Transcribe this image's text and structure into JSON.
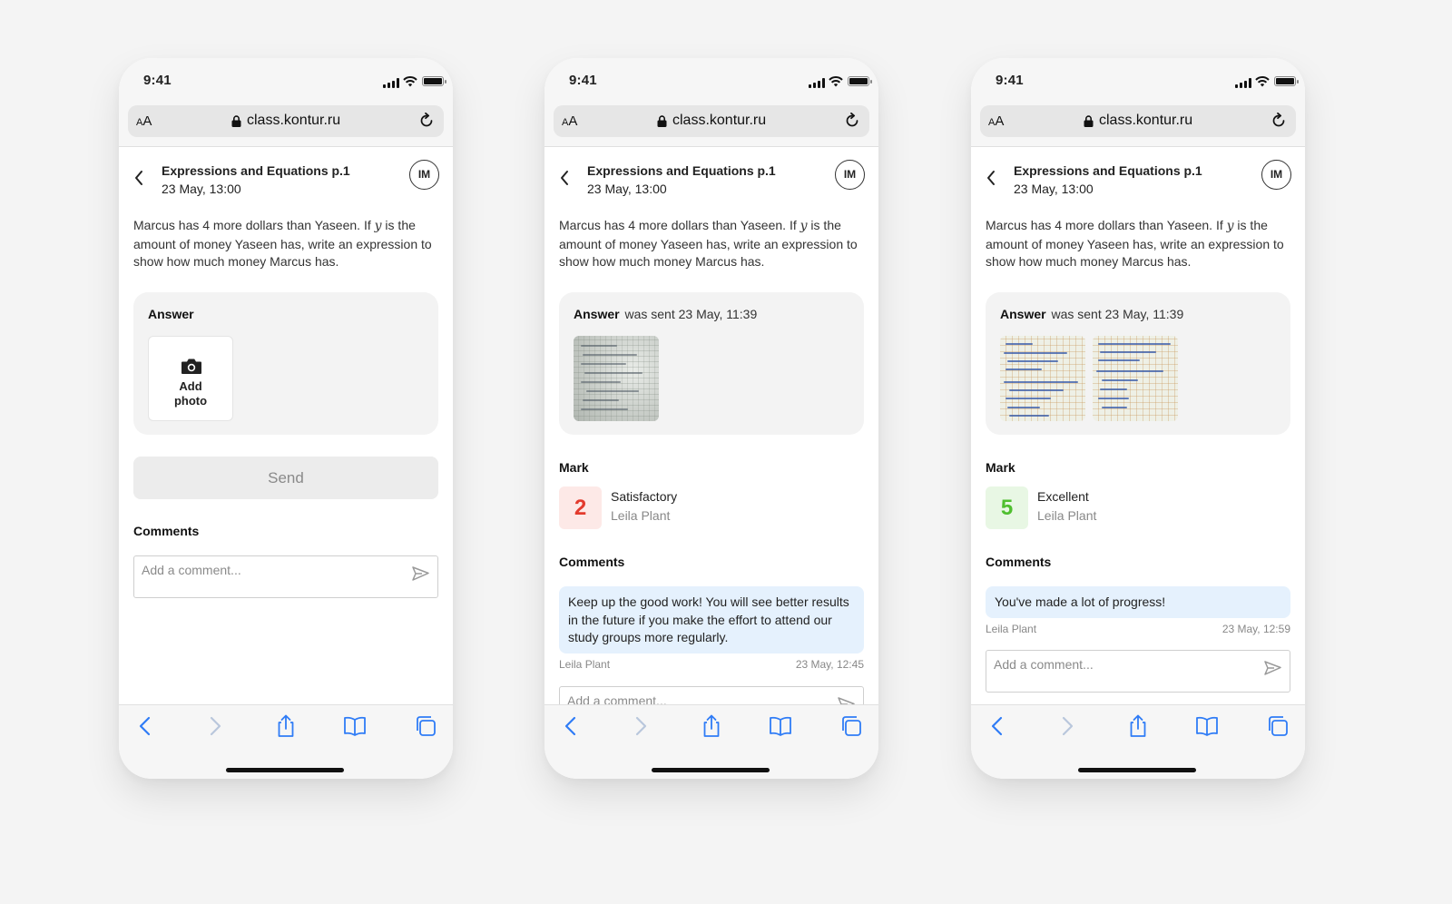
{
  "status": {
    "time": "9:41"
  },
  "browser": {
    "aa_big": "A",
    "aa_small": "A",
    "url": "class.kontur.ru"
  },
  "lesson": {
    "title": "Expressions and Equations p.1",
    "date": "23 May, 13:00",
    "avatar": "IM"
  },
  "question": {
    "before": "Marcus has 4 more dollars than Yaseen. If ",
    "variable": "y",
    "after": " is the amount of money Yaseen has, write an expression to show how much money Marcus has."
  },
  "labels": {
    "answer": "Answer",
    "was_sent": "was sent 23 May, 11:39",
    "add_photo_line1": "Add",
    "add_photo_line2": "photo",
    "send": "Send",
    "comments": "Comments",
    "mark": "Mark",
    "comment_placeholder": "Add a comment..."
  },
  "screens": {
    "draft": {},
    "graded_satisfactory": {
      "mark": {
        "value": "2",
        "text": "Satisfactory",
        "teacher": "Leila Plant",
        "color": "#e33b2e"
      },
      "comment": {
        "text": "Keep up the good work! You will see better results in the future if you make the effort to attend our study groups more regularly.",
        "author": "Leila Plant",
        "time": "23 May, 12:45"
      }
    },
    "graded_excellent": {
      "mark": {
        "value": "5",
        "text": "Excellent",
        "teacher": "Leila Plant",
        "color": "#4fbf2f"
      },
      "comment": {
        "text": "You've made a lot of progress!",
        "author": "Leila Plant",
        "time": "23 May, 12:59"
      }
    }
  },
  "icons": [
    "signal-icon",
    "wifi-icon",
    "battery-icon",
    "lock-icon",
    "reload-icon",
    "back-chevron-icon",
    "camera-icon",
    "send-icon",
    "browser-back-icon",
    "browser-forward-icon",
    "share-icon",
    "bookmarks-icon",
    "tabs-icon"
  ]
}
